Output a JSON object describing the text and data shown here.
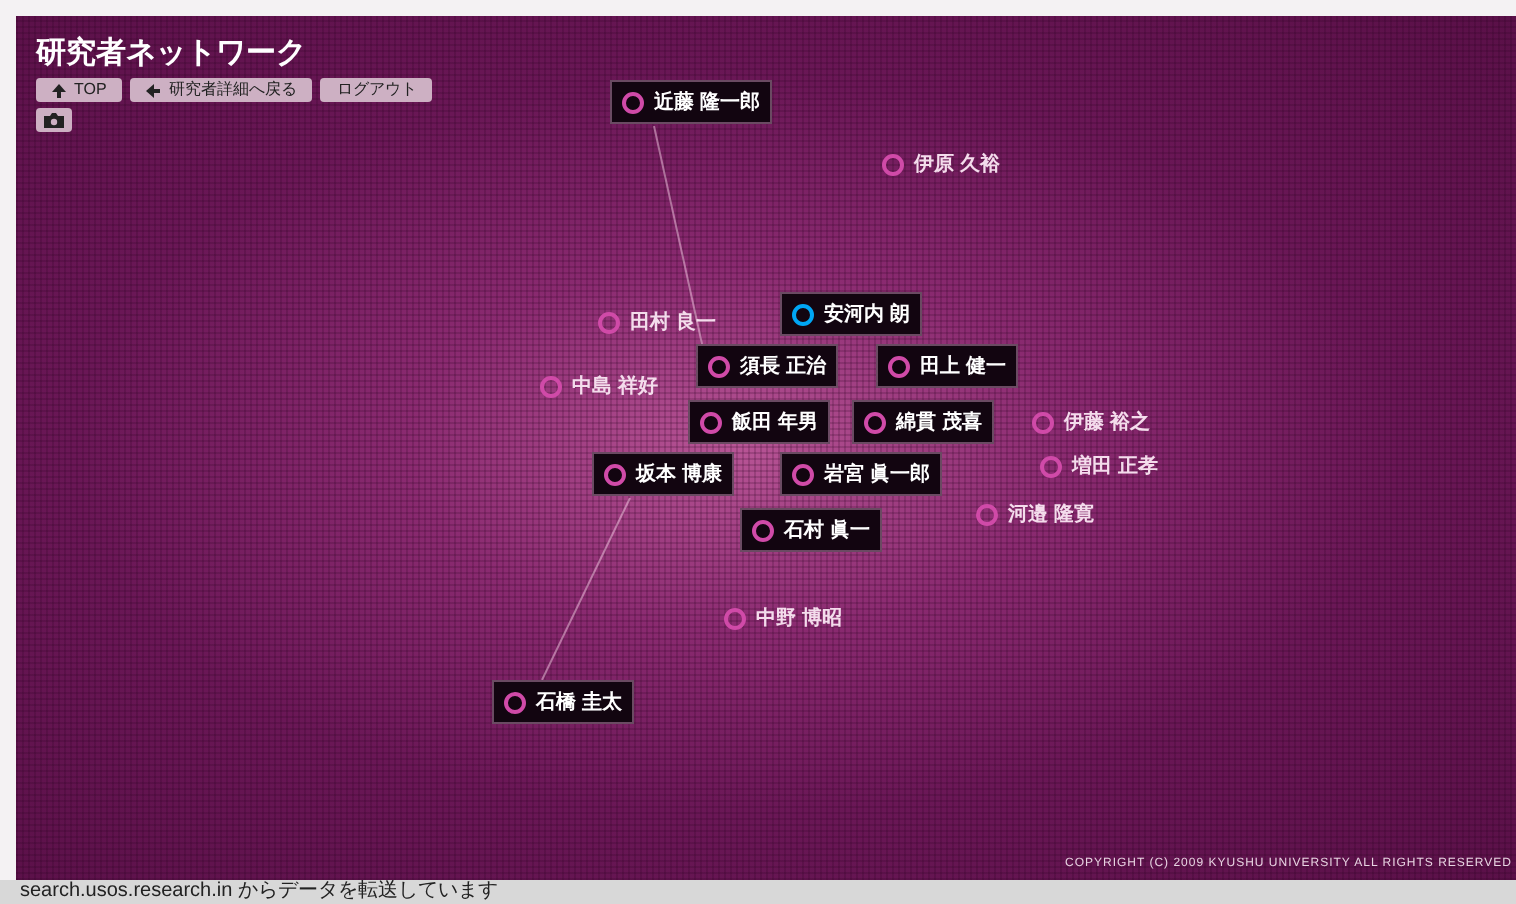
{
  "title": "研究者ネットワーク",
  "toolbar": [
    {
      "label": "TOP",
      "kind": "up"
    },
    {
      "label": "研究者詳細へ戻る",
      "kind": "back"
    },
    {
      "label": "ログアウト",
      "kind": "plain"
    }
  ],
  "nodes": [
    {
      "name": "伊原 久裕",
      "kind": "plain",
      "selected": false
    },
    {
      "name": "田村 良一",
      "kind": "plain",
      "selected": false
    },
    {
      "name": "中島 祥好",
      "kind": "plain",
      "selected": false
    },
    {
      "name": "伊藤 裕之",
      "kind": "plain",
      "selected": false
    },
    {
      "name": "増田 正孝",
      "kind": "plain",
      "selected": false
    },
    {
      "name": "河邉 隆寛",
      "kind": "plain",
      "selected": false
    },
    {
      "name": "中野 博昭",
      "kind": "plain",
      "selected": false
    },
    {
      "name": "近藤 隆一郎",
      "kind": "card",
      "selected": false
    },
    {
      "name": "須長 正治",
      "kind": "card",
      "selected": false
    },
    {
      "name": "安河内 朗",
      "kind": "card",
      "selected": true
    },
    {
      "name": "田上 健一",
      "kind": "card",
      "selected": false
    },
    {
      "name": "飯田 年男",
      "kind": "card",
      "selected": false
    },
    {
      "name": "坂本 博康",
      "kind": "card",
      "selected": false
    },
    {
      "name": "綿貫 茂喜",
      "kind": "card",
      "selected": false
    },
    {
      "name": "岩宮 眞一郎",
      "kind": "card",
      "selected": false
    },
    {
      "name": "石村 眞一",
      "kind": "card",
      "selected": false
    },
    {
      "name": "石橋 圭太",
      "kind": "card",
      "selected": false
    }
  ],
  "copyright": "COPYRIGHT (C) 2009 KYUSHU UNIVERSITY ALL RIGHTS RESERVED",
  "status_bar": "search.usos.research.in からデータを転送しています"
}
